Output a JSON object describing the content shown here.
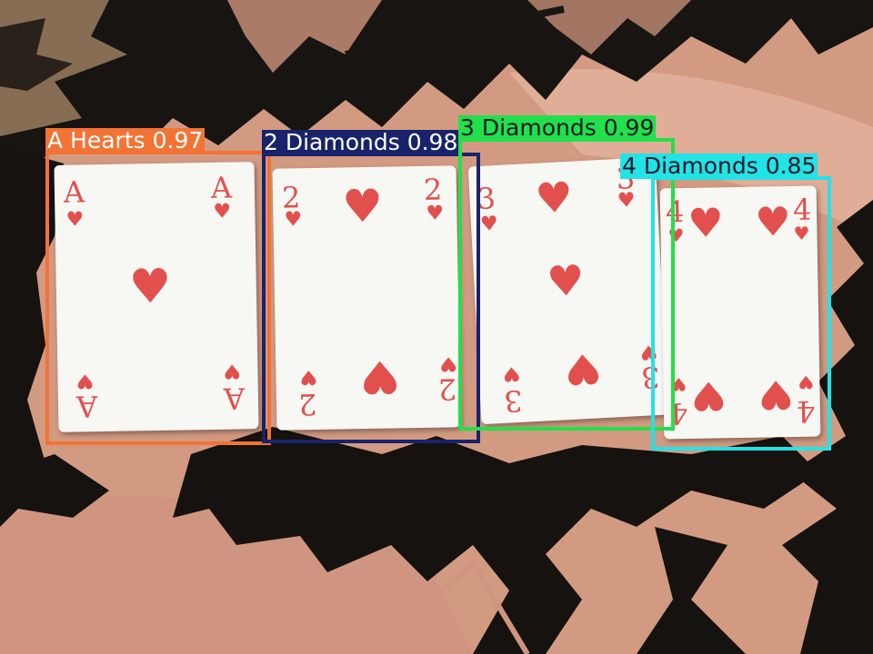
{
  "image": {
    "description_colors": {
      "cloth_pink": "#d59e86",
      "cloth_dark": "#141210",
      "card_face": "#f7f7f4",
      "suit_red": "#e2504d"
    }
  },
  "cards": [
    {
      "rank": "A",
      "suit_glyph": "♥",
      "name": "ace-of-hearts"
    },
    {
      "rank": "2",
      "suit_glyph": "♥",
      "name": "two-of-hearts"
    },
    {
      "rank": "3",
      "suit_glyph": "♥",
      "name": "three-of-hearts"
    },
    {
      "rank": "4",
      "suit_glyph": "♥",
      "name": "four-of-hearts"
    }
  ],
  "detections": [
    {
      "label": "A Hearts 0.97",
      "class": "A Hearts",
      "confidence": 0.97,
      "color": "#f37335"
    },
    {
      "label": "2 Diamonds 0.98",
      "class": "2 Diamonds",
      "confidence": 0.98,
      "color": "#18236b"
    },
    {
      "label": "3 Diamonds 0.99",
      "class": "3 Diamonds",
      "confidence": 0.99,
      "color": "#22e04b"
    },
    {
      "label": "4 Diamonds 0.85",
      "class": "4 Diamonds",
      "confidence": 0.85,
      "color": "#22e3e6"
    }
  ]
}
